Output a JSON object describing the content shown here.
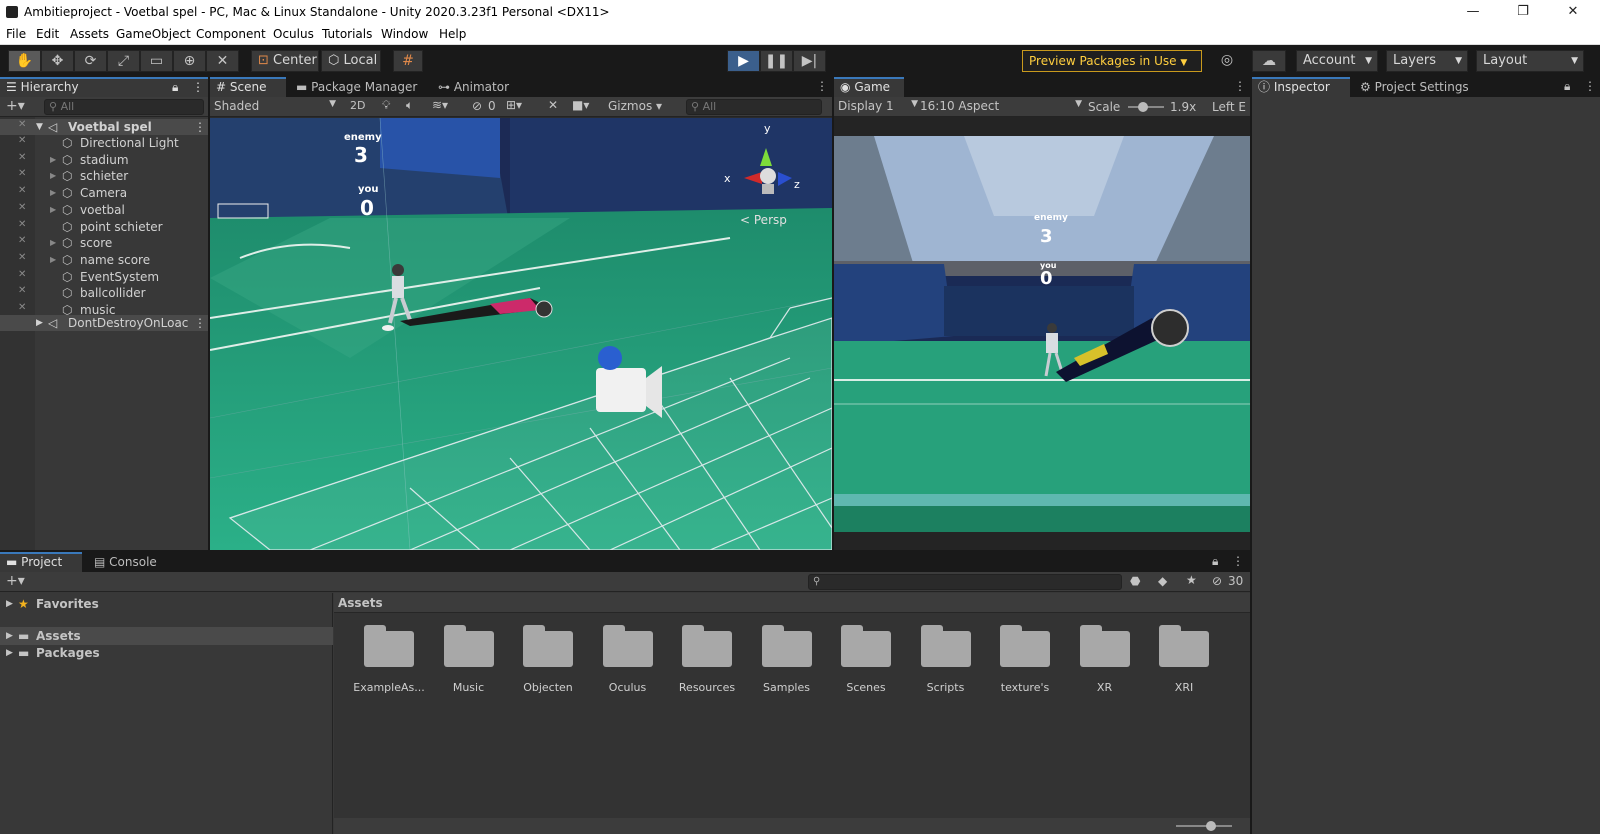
{
  "window": {
    "title": "Ambitieproject - Voetbal spel - PC, Mac & Linux Standalone - Unity 2020.3.23f1 Personal <DX11>",
    "minimize": "—",
    "restore": "❐",
    "close": "✕"
  },
  "menu": [
    "File",
    "Edit",
    "Assets",
    "GameObject",
    "Component",
    "Oculus",
    "Tutorials",
    "Window",
    "Help"
  ],
  "toolbar": {
    "pivot": "Center",
    "space": "Local",
    "preview_packages": "Preview Packages in Use",
    "account": "Account",
    "layers": "Layers",
    "layout": "Layout"
  },
  "hierarchy": {
    "tab": "Hierarchy",
    "search_placeholder": "All",
    "scene_name": "Voetbal spel",
    "items": [
      "Directional Light",
      "stadium",
      "schieter",
      "Camera",
      "voetbal",
      "point schieter",
      "score",
      "name score",
      "EventSystem",
      "ballcollider",
      "music"
    ],
    "dont_destroy": "DontDestroyOnLoac"
  },
  "scene_view": {
    "tabs": [
      "Scene",
      "Package Manager",
      "Animator"
    ],
    "shading": "Shaded",
    "mode_2d": "2D",
    "hidden_count": "0",
    "gizmos": "Gizmos",
    "search_placeholder": "All",
    "persp": "Persp",
    "axis_x": "x",
    "axis_y": "y",
    "axis_z": "z",
    "score_enemy_label": "enemy",
    "score_enemy_value": "3",
    "score_you_label": "you",
    "score_you_value": "0"
  },
  "game_view": {
    "tab": "Game",
    "display": "Display 1",
    "aspect": "16:10 Aspect",
    "scale_label": "Scale",
    "scale_value": "1.9x",
    "left_eye": "Left E",
    "score_enemy_label": "enemy",
    "score_enemy_value": "3",
    "score_you_label": "you",
    "score_you_value": "0"
  },
  "inspector": {
    "tabs": [
      "Inspector",
      "Project Settings"
    ]
  },
  "project": {
    "tabs": [
      "Project",
      "Console"
    ],
    "favorites": "Favorites",
    "tree": [
      "Assets",
      "Packages"
    ],
    "breadcrumb": "Assets",
    "hidden_count": "30",
    "folders": [
      "ExampleAs...",
      "Music",
      "Objecten",
      "Oculus",
      "Resources",
      "Samples",
      "Scenes",
      "Scripts",
      "texture's",
      "XR",
      "XRI"
    ]
  },
  "colors": {
    "accent_blue": "#3a79bb",
    "warning_yellow": "#ffcf3f",
    "pitch_green": "#2a9c77"
  }
}
